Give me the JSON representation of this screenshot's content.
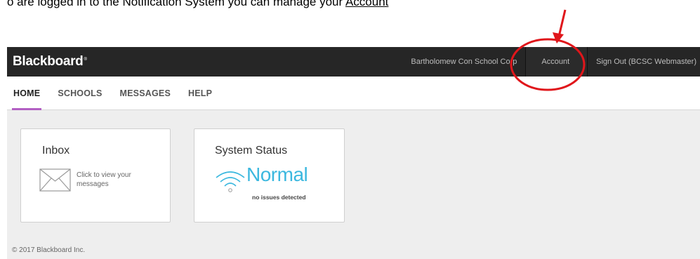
{
  "doc": {
    "text_lead": "o are logged in to the Notification System you can manage your ",
    "text_tail": "Account"
  },
  "topbar": {
    "logo": "Blackboard",
    "institution": "Bartholomew Con School Corp",
    "account_label": "Account",
    "signout_label": "Sign Out (BCSC Webmaster)"
  },
  "nav": {
    "items": [
      {
        "label": "HOME",
        "active": true
      },
      {
        "label": "SCHOOLS",
        "active": false
      },
      {
        "label": "MESSAGES",
        "active": false
      },
      {
        "label": "HELP",
        "active": false
      }
    ]
  },
  "inbox": {
    "title": "Inbox",
    "text": "Click to view your messages",
    "icon": "envelope-icon"
  },
  "status": {
    "title": "System Status",
    "value": "Normal",
    "subtext": "no issues detected",
    "icon": "wifi-icon"
  },
  "footer": {
    "copyright": "© 2017 Blackboard Inc."
  },
  "colors": {
    "topbar_bg": "#262626",
    "nav_active_underline": "#b25fc3",
    "status_accent": "#3cb8df",
    "annotation_red": "#e0161b"
  }
}
